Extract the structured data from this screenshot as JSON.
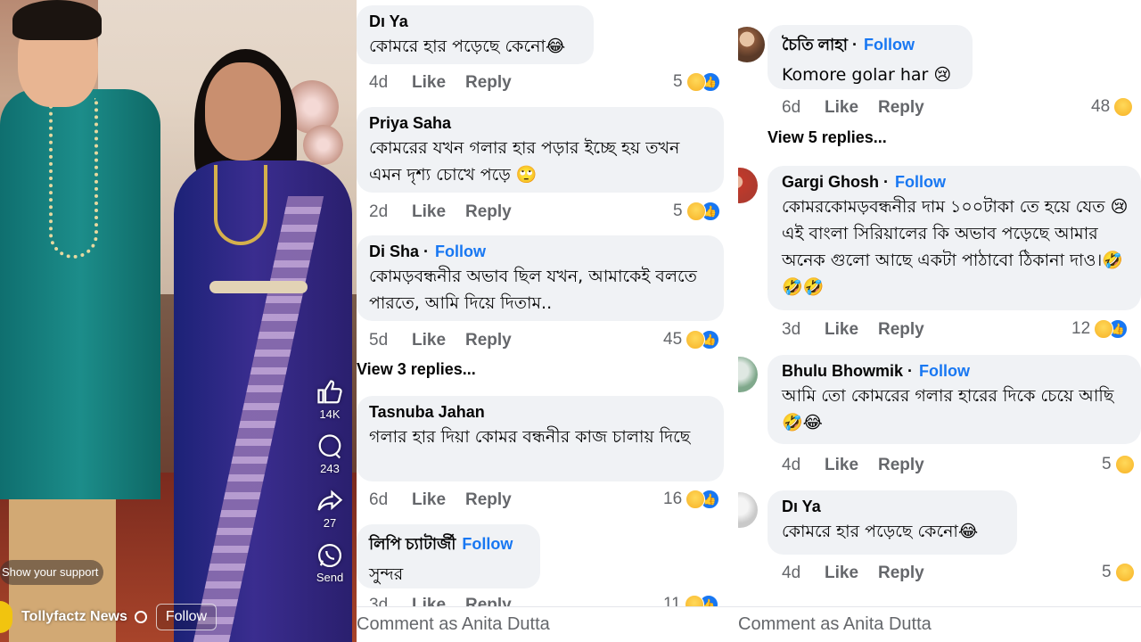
{
  "video": {
    "likes": "14K",
    "comments": "243",
    "shares": "27",
    "send_label": "Send",
    "support_label": "Show your support",
    "page_name": "Tollyfactz News",
    "follow_label": "Follow",
    "icons": [
      "like-icon",
      "comment-icon",
      "share-icon",
      "whatsapp-icon",
      "globe-icon"
    ]
  },
  "left_comments": {
    "items": [
      {
        "name": "Dı Ya",
        "follow": "",
        "text": "কোমরে হার পড়েছে কেনো😂",
        "time": "4d",
        "like": "Like",
        "reply": "Reply",
        "count": "5"
      },
      {
        "name": "Priya Saha",
        "follow": "",
        "text": "কোমরের  যখন গলার হার পড়ার ইচ্ছে হয় তখন এমন দৃশ্য চোখে পড়ে 🙄",
        "time": "2d",
        "like": "Like",
        "reply": "Reply",
        "count": "5"
      },
      {
        "name": "Di Sha",
        "follow": "Follow",
        "text": "কোমড়বন্ধনীর অভাব ছিল যখন, আমাকেই বলতে পারতে, আমি দিয়ে দিতাম..",
        "time": "5d",
        "like": "Like",
        "reply": "Reply",
        "count": "45"
      },
      {
        "name": "Tasnuba Jahan",
        "follow": "",
        "text": "গলার হার দিয়া কোমর বন্ধনীর কাজ চালায় দিছে",
        "time": "6d",
        "like": "Like",
        "reply": "Reply",
        "count": "16"
      },
      {
        "name": "লিপি চ্যাটার্জী",
        "follow": "Follow",
        "text": "সুন্দর",
        "time": "3d",
        "like": "Like",
        "reply": "Reply",
        "count": "11"
      }
    ],
    "view_replies": "View 3 replies...",
    "composer": "Comment as Anita Dutta"
  },
  "right_comments": {
    "items": [
      {
        "name": "চৈতি লাহা",
        "follow": "Follow",
        "text": "Komore golar har 😢",
        "time": "6d",
        "like": "Like",
        "reply": "Reply",
        "count": "48"
      },
      {
        "name": "Gargi Ghosh",
        "follow": "Follow",
        "text": "কোমরকোমড়বন্ধনীর দাম  ১০০টাকা তে হয়ে যেত 😢 এই বাংলা সিরিয়ালের কি অভাব পড়েছে আমার অনেক গুলো আছে একটা পাঠাবো ঠিকানা দাও।🤣🤣🤣",
        "time": "3d",
        "like": "Like",
        "reply": "Reply",
        "count": "12"
      },
      {
        "name": "Bhulu Bhowmik",
        "follow": "Follow",
        "text": "আমি তো কোমরের গলার হারের দিকে চেয়ে আছি 🤣😂",
        "time": "4d",
        "like": "Like",
        "reply": "Reply",
        "count": "5"
      },
      {
        "name": "Dı Ya",
        "follow": "",
        "text": "কোমরে হার পড়েছে কেনো😂",
        "time": "4d",
        "like": "Like",
        "reply": "Reply",
        "count": "5"
      }
    ],
    "view_replies": "View 5 replies...",
    "composer": "Comment as Anita Dutta"
  },
  "colors": {
    "follow_blue": "#1877f2",
    "bubble_gray": "#f0f2f5",
    "meta_gray": "#65676b"
  }
}
